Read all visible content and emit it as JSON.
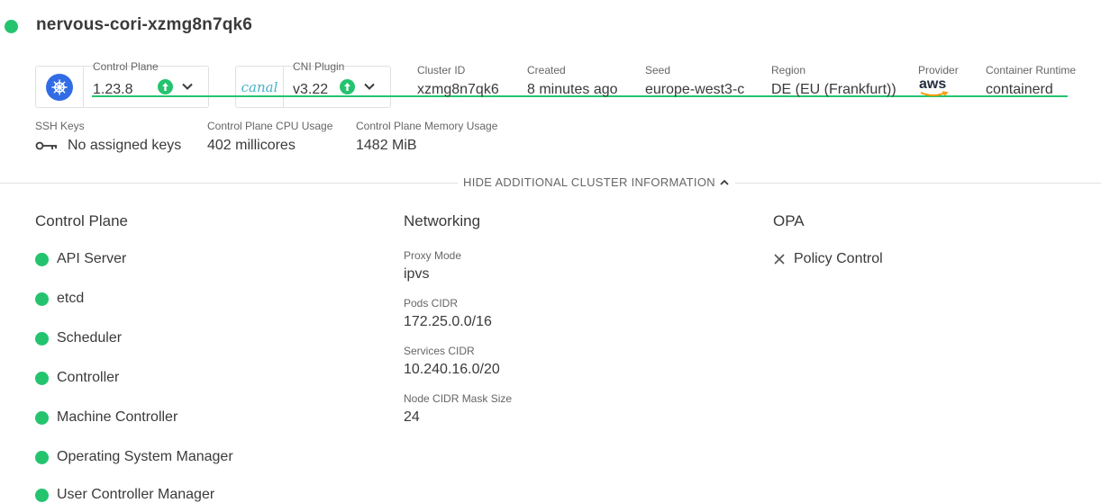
{
  "cluster": {
    "name": "nervous-cori-xzmg8n7qk6"
  },
  "control_plane": {
    "label": "Control Plane",
    "version": "1.23.8"
  },
  "cni_plugin": {
    "logo_text": "canal",
    "label": "CNI Plugin",
    "version": "v3.22"
  },
  "info": {
    "cluster_id": {
      "label": "Cluster ID",
      "value": "xzmg8n7qk6"
    },
    "created": {
      "label": "Created",
      "value": "8 minutes ago"
    },
    "seed": {
      "label": "Seed",
      "value": "europe-west3-c"
    },
    "region": {
      "label": "Region",
      "value": "DE (EU (Frankfurt))"
    },
    "provider": {
      "label": "Provider",
      "value": "aws"
    },
    "runtime": {
      "label": "Container Runtime",
      "value": "containerd"
    }
  },
  "ssh": {
    "label": "SSH Keys",
    "value": "No assigned keys"
  },
  "cpu": {
    "label": "Control Plane CPU Usage",
    "value": "402 millicores"
  },
  "memory": {
    "label": "Control Plane Memory Usage",
    "value": "1482 MiB"
  },
  "toggle": {
    "label": "HIDE ADDITIONAL CLUSTER INFORMATION"
  },
  "sections": {
    "control_plane": {
      "title": "Control Plane",
      "items": [
        "API Server",
        "etcd",
        "Scheduler",
        "Controller",
        "Machine Controller",
        "Operating System Manager",
        "User Controller Manager"
      ]
    },
    "networking": {
      "title": "Networking",
      "fields": [
        {
          "label": "Proxy Mode",
          "value": "ipvs"
        },
        {
          "label": "Pods CIDR",
          "value": "172.25.0.0/16"
        },
        {
          "label": "Services CIDR",
          "value": "10.240.16.0/20"
        },
        {
          "label": "Node CIDR Mask Size",
          "value": "24"
        }
      ]
    },
    "opa": {
      "title": "OPA",
      "items": [
        "Policy Control"
      ]
    }
  },
  "colors": {
    "healthy": "#24c46f",
    "k8s_blue": "#326ce5",
    "aws_orange": "#ff9900"
  },
  "icons": [
    "status-dot",
    "kubernetes-icon",
    "canal-logo",
    "upgrade-available-icon",
    "chevron-down-icon",
    "aws-logo",
    "key-icon",
    "chevron-up-icon",
    "close-icon"
  ]
}
